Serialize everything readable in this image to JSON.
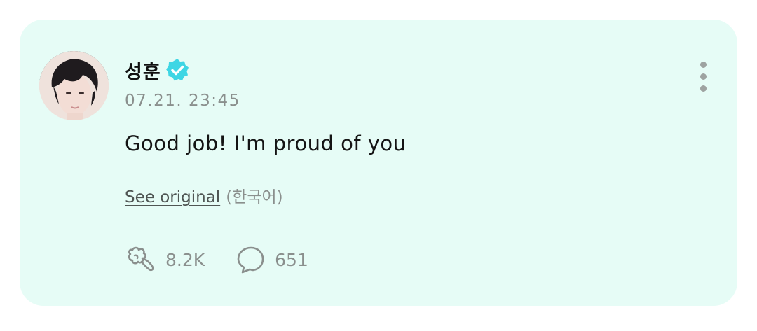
{
  "post": {
    "author": {
      "name": "성훈",
      "verified_icon": "verified-check-badge",
      "verified_color": "#3ed6e4"
    },
    "timestamp": "07.21. 23:45",
    "message": "Good job! I'm proud of you",
    "translation": {
      "link_label": "See original",
      "language": "(한국어)"
    },
    "stats": {
      "likes": "8.2K",
      "like_icon": "like-puff-icon",
      "comments": "651",
      "comment_icon": "comment-bubble-icon"
    },
    "menu_icon": "more-vertical-icon"
  },
  "colors": {
    "card_background": "#e6fcf6",
    "muted_text": "#8a8f8d",
    "primary_text": "#141414"
  }
}
